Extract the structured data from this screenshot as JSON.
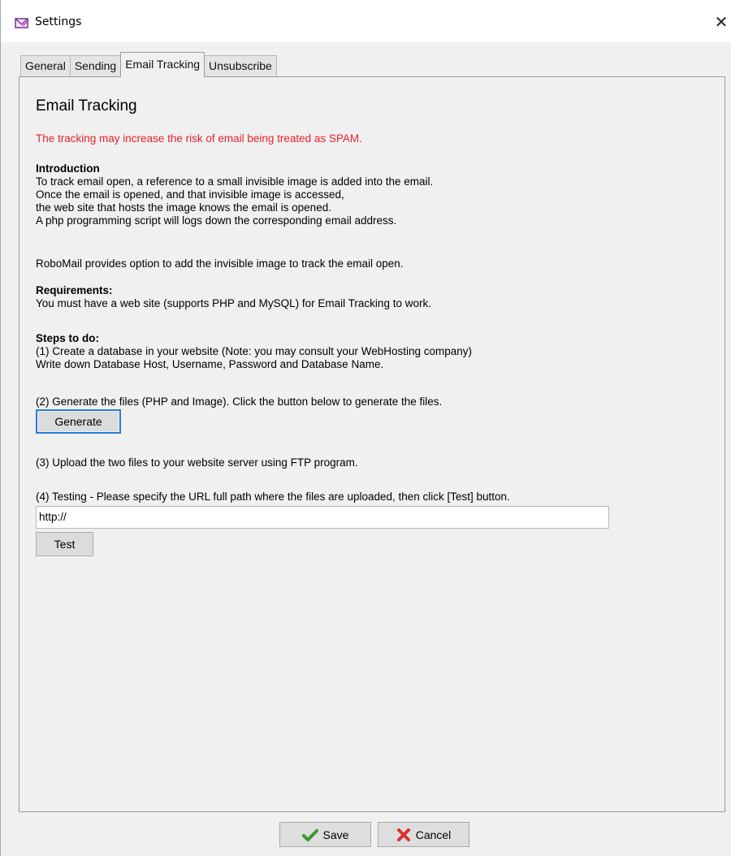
{
  "window": {
    "title": "Settings",
    "close_glyph": "✕",
    "app_icon": "envelope-icon"
  },
  "tabs": [
    {
      "label": "General",
      "active": false
    },
    {
      "label": "Sending",
      "active": false
    },
    {
      "label": "Email Tracking",
      "active": true
    },
    {
      "label": "Unsubscribe",
      "active": false
    }
  ],
  "panel": {
    "heading": "Email Tracking",
    "warning": "The tracking may increase the risk of email being treated as SPAM.",
    "intro": {
      "title": "Introduction",
      "lines": [
        "To track email open, a reference to a small invisible image is added into the email.",
        "Once the email is opened, and that invisible image is accessed,",
        "the web site that hosts the image knows the email is opened.",
        "A php programming script will logs down the corresponding email address."
      ]
    },
    "robomail_note": "RoboMail provides option to add the invisible image to track the email open.",
    "requirements": {
      "title": "Requirements:",
      "text": "You must have a web site (supports PHP and MySQL) for Email Tracking to work."
    },
    "steps": {
      "title": "Steps to do:",
      "step1_line1": "(1) Create a database in your website (Note: you may consult your WebHosting company)",
      "step1_line2": "Write down Database Host, Username, Password and Database Name.",
      "step2": "(2) Generate the files (PHP and Image). Click the button below to generate the files.",
      "generate_label": "Generate",
      "step3": "(3) Upload the two files to your website server using FTP program.",
      "step4": "(4) Testing - Please specify the URL full path where the files are uploaded, then click [Test] button.",
      "url_value": "http://",
      "test_label": "Test"
    }
  },
  "footer": {
    "save_label": "Save",
    "save_icon": "checkmark-icon",
    "cancel_label": "Cancel",
    "cancel_icon": "red-x-icon"
  },
  "colors": {
    "warning": "#e5232d",
    "focus": "#2a7bd8",
    "save_check": "#3a9a2e",
    "cancel_x": "#d8322a"
  }
}
